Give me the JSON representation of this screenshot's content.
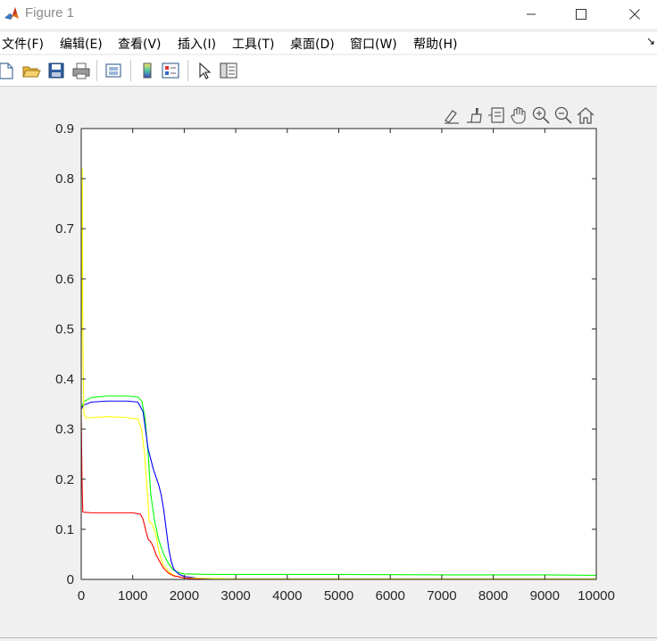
{
  "window": {
    "title": "Figure 1",
    "icon": "matlab-logo-icon",
    "controls": [
      "minimize-icon",
      "maximize-icon",
      "close-icon"
    ]
  },
  "menubar": {
    "items": [
      "文件(F)",
      "编辑(E)",
      "查看(V)",
      "插入(I)",
      "工具(T)",
      "桌面(D)",
      "窗口(W)",
      "帮助(H)"
    ],
    "overflow_icon": "dock-arrow-icon"
  },
  "toolbar": {
    "buttons": [
      "new-figure-icon",
      "open-file-icon",
      "save-icon",
      "print-icon",
      "link-plot-icon",
      "colorbar-icon",
      "legend-icon",
      "edit-plot-icon",
      "property-inspector-icon"
    ]
  },
  "axes_toolbar": {
    "buttons": [
      "brush-export-icon",
      "data-brush-icon",
      "data-tips-icon",
      "pan-icon",
      "zoom-in-icon",
      "zoom-out-icon",
      "restore-view-icon"
    ]
  },
  "chart_data": {
    "type": "line",
    "title": "",
    "xlabel": "",
    "ylabel": "",
    "xlim": [
      0,
      10000
    ],
    "ylim": [
      0,
      0.9
    ],
    "xticks": [
      "0",
      "1000",
      "2000",
      "3000",
      "4000",
      "5000",
      "6000",
      "7000",
      "8000",
      "9000",
      "10000"
    ],
    "yticks": [
      "0",
      "0.1",
      "0.2",
      "0.3",
      "0.4",
      "0.5",
      "0.6",
      "0.7",
      "0.8",
      "0.9"
    ],
    "grid": false,
    "series": [
      {
        "color": "#00ff00",
        "x": [
          0,
          50,
          200,
          500,
          900,
          1100,
          1180,
          1240,
          1300,
          1350,
          1420,
          1500,
          1600,
          1700,
          1800,
          1900,
          2000,
          2500,
          3000,
          5000,
          7000,
          9000,
          10000
        ],
        "y": [
          0.34,
          0.355,
          0.363,
          0.366,
          0.366,
          0.364,
          0.355,
          0.32,
          0.25,
          0.17,
          0.12,
          0.08,
          0.05,
          0.03,
          0.018,
          0.013,
          0.011,
          0.01,
          0.01,
          0.01,
          0.009,
          0.009,
          0.008
        ]
      },
      {
        "color": "#0000ff",
        "x": [
          0,
          50,
          200,
          500,
          900,
          1100,
          1200,
          1300,
          1400,
          1500,
          1550,
          1600,
          1650,
          1700,
          1750,
          1800,
          1900,
          2000,
          2300,
          2700,
          3000,
          5000,
          7000,
          10000
        ],
        "y": [
          0.34,
          0.348,
          0.354,
          0.356,
          0.356,
          0.354,
          0.335,
          0.26,
          0.22,
          0.19,
          0.17,
          0.14,
          0.1,
          0.06,
          0.035,
          0.02,
          0.01,
          0.006,
          0.002,
          0.001,
          0.001,
          0.001,
          0.001,
          0.001
        ]
      },
      {
        "color": "#ffff00",
        "x": [
          0,
          10,
          20,
          30,
          50,
          100,
          200,
          500,
          900,
          1100,
          1170,
          1230,
          1280,
          1320,
          1380,
          1450,
          1500,
          1550,
          1600,
          1700,
          1800,
          1900,
          2000,
          2500,
          3000,
          5000,
          10000
        ],
        "y": [
          0.33,
          0.6,
          0.82,
          0.5,
          0.33,
          0.322,
          0.323,
          0.325,
          0.323,
          0.32,
          0.3,
          0.25,
          0.18,
          0.115,
          0.11,
          0.09,
          0.06,
          0.04,
          0.028,
          0.015,
          0.008,
          0.005,
          0.003,
          0.002,
          0.001,
          0.001,
          0.001
        ]
      },
      {
        "color": "#ff0000",
        "x": [
          0,
          15,
          30,
          60,
          200,
          500,
          1000,
          1150,
          1200,
          1260,
          1300,
          1350,
          1400,
          1450,
          1500,
          1600,
          1700,
          1800,
          2000,
          2200,
          2500,
          3000,
          10000
        ],
        "y": [
          0.33,
          0.2,
          0.135,
          0.134,
          0.133,
          0.133,
          0.133,
          0.13,
          0.12,
          0.095,
          0.08,
          0.075,
          0.065,
          0.05,
          0.04,
          0.022,
          0.012,
          0.007,
          0.003,
          0.001,
          0.0,
          0.0,
          0.0
        ]
      }
    ]
  }
}
